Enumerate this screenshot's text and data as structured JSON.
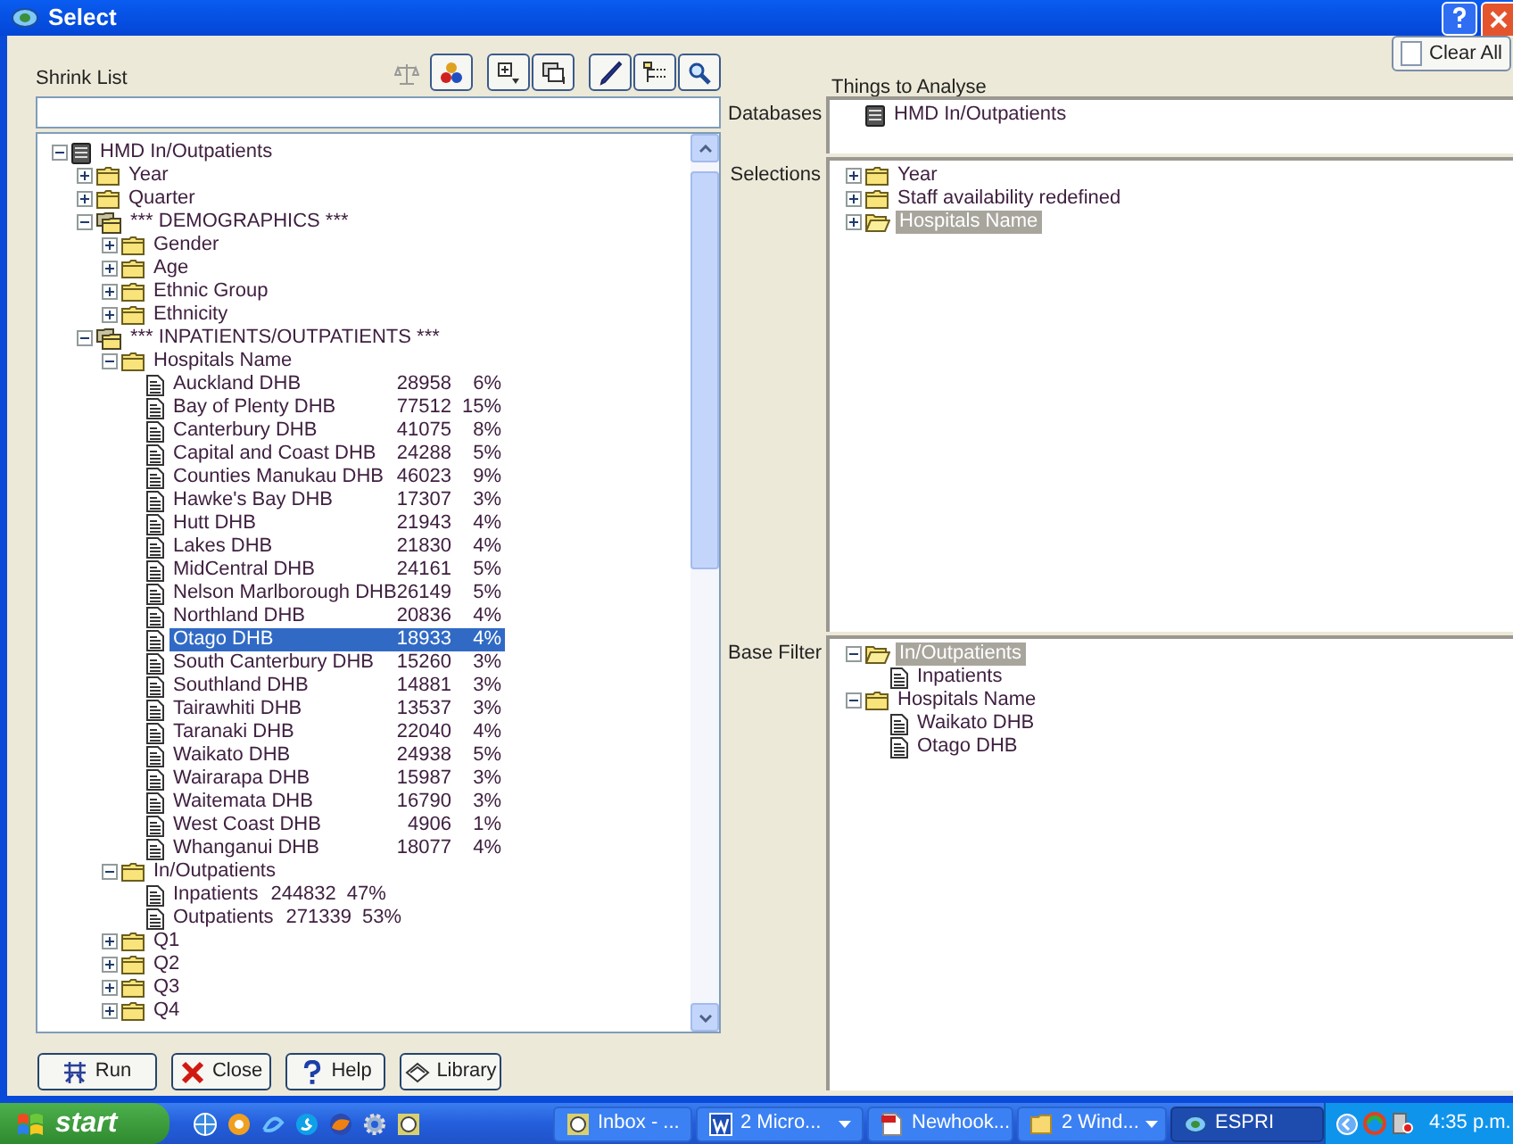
{
  "window": {
    "title": "Select"
  },
  "shrink_list": {
    "label": "Shrink List"
  },
  "toolbar": [
    {
      "kind": "scales",
      "disabled": true
    },
    {
      "kind": "circles",
      "disabled": false
    },
    {
      "kind": "expand",
      "disabled": false
    },
    {
      "kind": "collapse",
      "disabled": false
    },
    {
      "kind": "pen",
      "disabled": false
    },
    {
      "kind": "tree",
      "disabled": false
    },
    {
      "kind": "magnifier",
      "disabled": false
    }
  ],
  "tree": [
    {
      "kind": "database",
      "label": "HMD In/Outpatients",
      "expanded": true,
      "selected": false,
      "children": [
        {
          "kind": "folder",
          "label": "Year",
          "expanded": false,
          "selected": false
        },
        {
          "kind": "folder",
          "label": "Quarter",
          "expanded": false,
          "selected": false
        },
        {
          "kind": "group",
          "label": "*** DEMOGRAPHICS ***",
          "expanded": true,
          "selected": false,
          "children": [
            {
              "kind": "folder",
              "label": "Gender",
              "expanded": false,
              "selected": false
            },
            {
              "kind": "folder",
              "label": "Age",
              "expanded": false,
              "selected": false
            },
            {
              "kind": "folder",
              "label": "Ethnic Group",
              "expanded": false,
              "selected": false
            },
            {
              "kind": "folder",
              "label": "Ethnicity",
              "expanded": false,
              "selected": false
            }
          ]
        },
        {
          "kind": "group",
          "label": "*** INPATIENTS/OUTPATIENTS ***",
          "expanded": true,
          "selected": false,
          "children": [
            {
              "kind": "folder",
              "label": "Hospitals Name",
              "expanded": true,
              "selected": false,
              "aligned": true,
              "children": [
                {
                  "kind": "doc",
                  "label": "Auckland DHB",
                  "count": "28958",
                  "share": "6%",
                  "selected": false
                },
                {
                  "kind": "doc",
                  "label": "Bay of Plenty DHB",
                  "count": "77512",
                  "share": "15%",
                  "selected": false
                },
                {
                  "kind": "doc",
                  "label": "Canterbury DHB",
                  "count": "41075",
                  "share": "8%",
                  "selected": false
                },
                {
                  "kind": "doc",
                  "label": "Capital and Coast DHB",
                  "count": "24288",
                  "share": "5%",
                  "selected": false
                },
                {
                  "kind": "doc",
                  "label": "Counties Manukau DHB",
                  "count": "46023",
                  "share": "9%",
                  "selected": false
                },
                {
                  "kind": "doc",
                  "label": "Hawke's Bay DHB",
                  "count": "17307",
                  "share": "3%",
                  "selected": false
                },
                {
                  "kind": "doc",
                  "label": "Hutt DHB",
                  "count": "21943",
                  "share": "4%",
                  "selected": false
                },
                {
                  "kind": "doc",
                  "label": "Lakes DHB",
                  "count": "21830",
                  "share": "4%",
                  "selected": false
                },
                {
                  "kind": "doc",
                  "label": "MidCentral DHB",
                  "count": "24161",
                  "share": "5%",
                  "selected": false
                },
                {
                  "kind": "doc",
                  "label": "Nelson Marlborough DHB",
                  "count": "26149",
                  "share": "5%",
                  "selected": false
                },
                {
                  "kind": "doc",
                  "label": "Northland DHB",
                  "count": "20836",
                  "share": "4%",
                  "selected": false
                },
                {
                  "kind": "doc",
                  "label": "Otago DHB",
                  "count": "18933",
                  "share": "4%",
                  "selected": true
                },
                {
                  "kind": "doc",
                  "label": "South Canterbury DHB",
                  "count": "15260",
                  "share": "3%",
                  "selected": false
                },
                {
                  "kind": "doc",
                  "label": "Southland DHB",
                  "count": "14881",
                  "share": "3%",
                  "selected": false
                },
                {
                  "kind": "doc",
                  "label": "Tairawhiti DHB",
                  "count": "13537",
                  "share": "3%",
                  "selected": false
                },
                {
                  "kind": "doc",
                  "label": "Taranaki DHB",
                  "count": "22040",
                  "share": "4%",
                  "selected": false
                },
                {
                  "kind": "doc",
                  "label": "Waikato DHB",
                  "count": "24938",
                  "share": "5%",
                  "selected": false
                },
                {
                  "kind": "doc",
                  "label": "Wairarapa DHB",
                  "count": "15987",
                  "share": "3%",
                  "selected": false
                },
                {
                  "kind": "doc",
                  "label": "Waitemata DHB",
                  "count": "16790",
                  "share": "3%",
                  "selected": false
                },
                {
                  "kind": "doc",
                  "label": "West Coast DHB",
                  "count": "4906",
                  "share": "1%",
                  "selected": false
                },
                {
                  "kind": "doc",
                  "label": "Whanganui DHB",
                  "count": "18077",
                  "share": "4%",
                  "selected": false
                }
              ]
            },
            {
              "kind": "folder",
              "label": "In/Outpatients",
              "expanded": true,
              "selected": false,
              "aligned": false,
              "children": [
                {
                  "kind": "doc",
                  "label": "Inpatients",
                  "count": "244832",
                  "share": "47%",
                  "selected": false
                },
                {
                  "kind": "doc",
                  "label": "Outpatients",
                  "count": "271339",
                  "share": "53%",
                  "selected": false
                }
              ]
            },
            {
              "kind": "folder",
              "label": "Q1",
              "expanded": false,
              "selected": false
            },
            {
              "kind": "folder",
              "label": "Q2",
              "expanded": false,
              "selected": false
            },
            {
              "kind": "folder",
              "label": "Q3",
              "expanded": false,
              "selected": false
            },
            {
              "kind": "folder",
              "label": "Q4",
              "expanded": false,
              "selected": false
            }
          ]
        }
      ]
    }
  ],
  "buttons": [
    {
      "kind": "run",
      "label": "Run"
    },
    {
      "kind": "close",
      "label": "Close"
    },
    {
      "kind": "help",
      "label": "Help"
    },
    {
      "kind": "library",
      "label": "Library"
    }
  ],
  "analysis": {
    "title": "Things to Analyse",
    "clear_button": {
      "label": "Clear All"
    },
    "databases": {
      "label": "Databases",
      "items": [
        {
          "kind": "database",
          "label": "HMD In/Outpatients",
          "selected": false
        }
      ]
    },
    "selections": {
      "label": "Selections",
      "items": [
        {
          "kind": "folder",
          "label": "Year",
          "expanded": false,
          "selected": false
        },
        {
          "kind": "folder",
          "label": "Staff availability redefined",
          "expanded": false,
          "selected": false
        },
        {
          "kind": "open-folder",
          "label": "Hospitals Name",
          "expanded": false,
          "selected": true
        }
      ]
    },
    "base_filter": {
      "label": "Base Filter",
      "items": [
        {
          "kind": "open-folder",
          "label": "In/Outpatients",
          "expanded": true,
          "selected": true,
          "children": [
            {
              "kind": "doc",
              "label": "Inpatients",
              "selected": false
            }
          ]
        },
        {
          "kind": "folder",
          "label": "Hospitals Name",
          "expanded": true,
          "selected": false,
          "children": [
            {
              "kind": "doc",
              "label": "Waikato DHB",
              "selected": false
            },
            {
              "kind": "doc",
              "label": "Otago DHB",
              "selected": false
            }
          ]
        }
      ]
    }
  },
  "taskbar": {
    "start": "start",
    "tasks": [
      {
        "kind": "mail",
        "label": "Inbox - ...",
        "menu": false,
        "selected": false
      },
      {
        "kind": "word",
        "label": "2 Micro...",
        "menu": true,
        "selected": false
      },
      {
        "kind": "pdf",
        "label": "Newhook...",
        "menu": false,
        "selected": false
      },
      {
        "kind": "folder",
        "label": "2 Wind...",
        "menu": true,
        "selected": false
      },
      {
        "kind": "app",
        "label": "ESPRI",
        "menu": false,
        "selected": true
      }
    ],
    "clock": "4:35 p.m."
  }
}
